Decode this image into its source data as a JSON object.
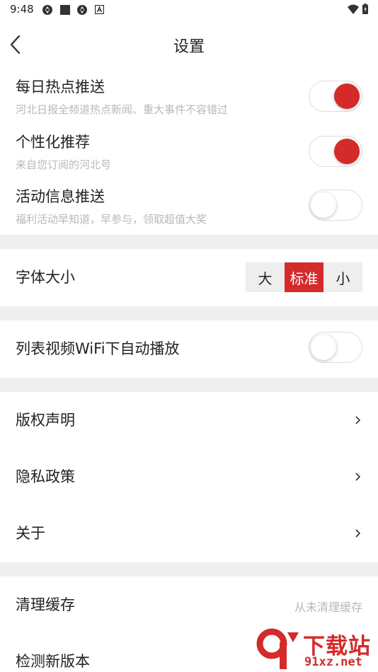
{
  "status_bar": {
    "time": "9:48",
    "icons": [
      "sync-icon",
      "square-icon",
      "sync-icon",
      "a-icon"
    ],
    "right_icons": [
      "wifi-icon",
      "battery-icon"
    ]
  },
  "header": {
    "title": "设置",
    "back_icon": "chevron-left-icon"
  },
  "push_section": [
    {
      "label": "每日热点推送",
      "desc": "河北日报全频道热点新闻、重大事件不容错过",
      "enabled": true
    },
    {
      "label": "个性化推荐",
      "desc": "来自您订阅的河北号",
      "enabled": true
    },
    {
      "label": "活动信息推送",
      "desc": "福利活动早知道，早参与，领取超值大奖",
      "enabled": false
    }
  ],
  "font_size": {
    "label": "字体大小",
    "options": [
      "大",
      "标准",
      "小"
    ],
    "selected": "标准"
  },
  "autoplay": {
    "label": "列表视频WiFi下自动播放",
    "enabled": false
  },
  "links": [
    {
      "label": "版权声明"
    },
    {
      "label": "隐私政策"
    },
    {
      "label": "关于"
    }
  ],
  "cache": {
    "label": "清理缓存",
    "status": "从未清理缓存"
  },
  "update": {
    "label": "检测新版本"
  },
  "watermark": {
    "text": "下载站",
    "url": "91xz.net"
  },
  "colors": {
    "accent": "#d42a2a",
    "divider": "#efefef",
    "subtext": "#b8b8b8"
  }
}
